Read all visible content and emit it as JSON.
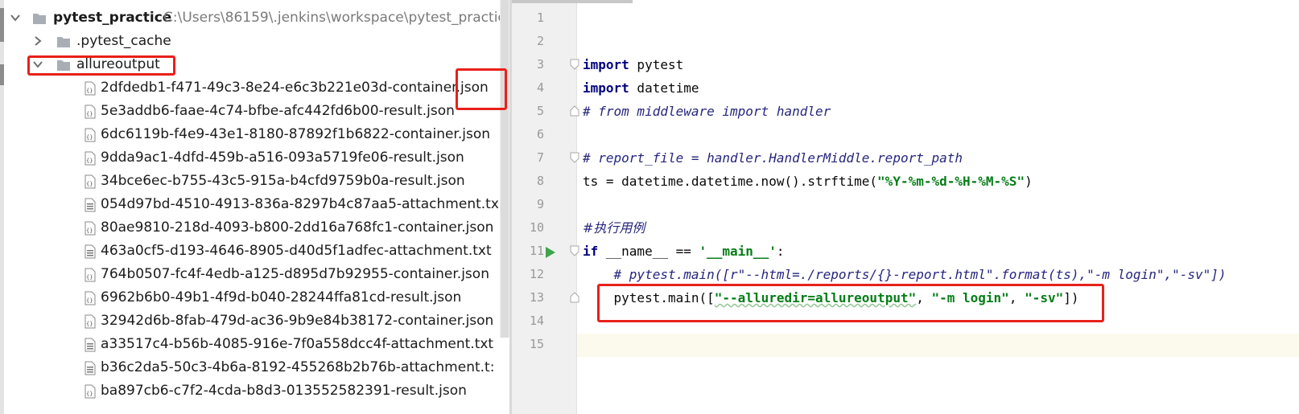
{
  "project_tree": {
    "root": {
      "name": "pytest_practice",
      "path": "C:\\Users\\86159\\.jenkins\\workspace\\pytest_practic"
    },
    "folders": [
      {
        "name": ".pytest_cache",
        "expanded": false
      },
      {
        "name": "allureoutput",
        "expanded": true
      }
    ],
    "files": [
      {
        "name": "2dfdedb1-f471-49c3-8e24-e6c3b221e03d-container.json",
        "type": "json"
      },
      {
        "name": "5e3addb6-faae-4c74-bfbe-afc442fd6b00-result.json",
        "type": "json"
      },
      {
        "name": "6dc6119b-f4e9-43e1-8180-87892f1b6822-container.json",
        "type": "json"
      },
      {
        "name": "9dda9ac1-4dfd-459b-a516-093a5719fe06-result.json",
        "type": "json"
      },
      {
        "name": "34bce6ec-b755-43c5-915a-b4cfd9759b0a-result.json",
        "type": "json"
      },
      {
        "name": "054d97bd-4510-4913-836a-8297b4c87aa5-attachment.tx",
        "type": "text"
      },
      {
        "name": "80ae9810-218d-4093-b800-2dd16a768fc1-container.json",
        "type": "json"
      },
      {
        "name": "463a0cf5-d193-4646-8905-d40d5f1adfec-attachment.txt",
        "type": "text"
      },
      {
        "name": "764b0507-fc4f-4edb-a125-d895d7b92955-container.json",
        "type": "json"
      },
      {
        "name": "6962b6b0-49b1-4f9d-b040-28244ffa81cd-result.json",
        "type": "json"
      },
      {
        "name": "32942d6b-8fab-479d-ac36-9b9e84b38172-container.json",
        "type": "json"
      },
      {
        "name": "a33517c4-b56b-4085-916e-7f0a558dcc4f-attachment.txt",
        "type": "text"
      },
      {
        "name": "b36c2da5-50c3-4b6a-8192-455268b2b76b-attachment.t:",
        "type": "text"
      },
      {
        "name": "ba897cb6-c7f2-4cda-b8d3-013552582391-result.json",
        "type": "json"
      }
    ]
  },
  "editor": {
    "line_numbers": [
      "1",
      "2",
      "3",
      "4",
      "5",
      "6",
      "7",
      "8",
      "9",
      "10",
      "11",
      "12",
      "13",
      "14",
      "15"
    ],
    "code": {
      "l3_kw": "import",
      "l3_rest": " pytest",
      "l4_kw": "import",
      "l4_rest": " datetime",
      "l5": "# from middleware import handler",
      "l7": "# report_file = handler.HandlerMiddle.report_path",
      "l8_a": "ts = datetime.datetime.now().strftime(",
      "l8_str": "\"%Y-%m-%d-%H-%M-%S\"",
      "l8_b": ")",
      "l10": "#执行用例",
      "l11_kw": "if",
      "l11_mid": " __name__ == ",
      "l11_str": "'__main__'",
      "l11_end": ":",
      "l12": "    # pytest.main([r\"--html=./reports/{}-report.html\".format(ts),\"-m login\",\"-sv\"])",
      "l13_a": "    pytest.main([",
      "l13_s1": "\"--alluredir=allureoutput\"",
      "l13_c1": ", ",
      "l13_s2": "\"-m login\"",
      "l13_c2": ", ",
      "l13_s3": "\"-sv\"",
      "l13_b": "])"
    }
  },
  "colors": {
    "annotation": "#e8201a",
    "keyword": "#000080",
    "string": "#067d17",
    "comment": "#26267e"
  }
}
